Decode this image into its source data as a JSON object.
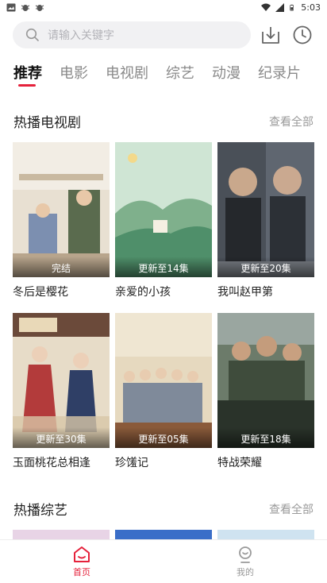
{
  "status_bar": {
    "time": "5:03"
  },
  "search": {
    "placeholder": "请输入关键字"
  },
  "tabs": [
    {
      "label": "推荐",
      "active": true
    },
    {
      "label": "电影",
      "active": false
    },
    {
      "label": "电视剧",
      "active": false
    },
    {
      "label": "综艺",
      "active": false
    },
    {
      "label": "动漫",
      "active": false
    },
    {
      "label": "纪录片",
      "active": false
    }
  ],
  "hot_tv": {
    "title": "热播电视剧",
    "see_all": "查看全部",
    "items": [
      {
        "title": "冬后是樱花",
        "badge": "完结"
      },
      {
        "title": "亲爱的小孩",
        "badge": "更新至14集"
      },
      {
        "title": "我叫赵甲第",
        "badge": "更新至20集"
      },
      {
        "title": "玉面桃花总相逢",
        "badge": "更新至30集"
      },
      {
        "title": "珍馐记",
        "badge": "更新至05集"
      },
      {
        "title": "特战荣耀",
        "badge": "更新至18集"
      }
    ]
  },
  "hot_variety": {
    "title": "热播综艺",
    "see_all": "查看全部"
  },
  "bottom_nav": [
    {
      "label": "首页",
      "active": true
    },
    {
      "label": "我的",
      "active": false
    }
  ],
  "colors": {
    "accent": "#e5213b",
    "muted": "#9a9a9a"
  }
}
